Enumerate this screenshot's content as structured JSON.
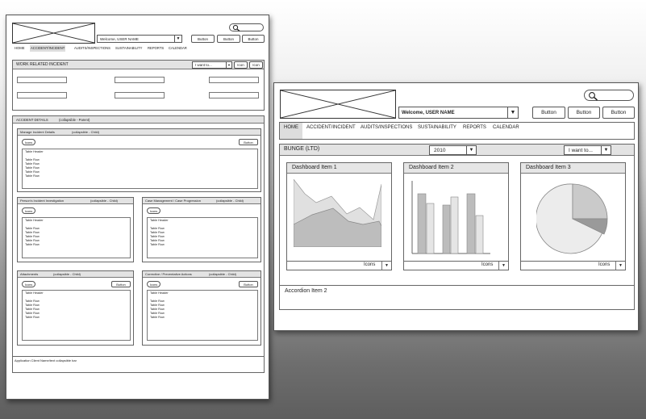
{
  "left": {
    "welcome": "Welcome, USER NAME",
    "buttons": [
      "Button",
      "Button",
      "Button"
    ],
    "nav": [
      "HOME",
      "ACCIDENT/INCIDENT",
      "AUDITS/INSPECTIONS",
      "SUSTAINABILITY",
      "REPORTS",
      "CALENDAR"
    ],
    "incident_title": "WORK RELATED INCIDENT",
    "i_want": "I want to...",
    "icon1": "Icon",
    "icon2": "Icon",
    "accident_details": "ACCIDENT DETAILS",
    "parent_note": "(collapsible - Parent)",
    "child_note": "(collapsible - Child)",
    "manage": "Manage Incident Details",
    "icons_pill": "Icons",
    "button": "Button",
    "table_header": "Table Header",
    "table_row": "Table Row",
    "persons": "Person's Incident Investigation",
    "case": "Case Management / Case Progression",
    "attachments": "Attachments",
    "corrective": "Corrective / Preventative Actions",
    "footer": "Application Client Name/text collapsible bar"
  },
  "right": {
    "welcome": "Welcome, USER NAME",
    "buttons": [
      "Button",
      "Button",
      "Button"
    ],
    "nav": [
      "HOME",
      "ACCIDENT/INCIDENT",
      "AUDITS/INSPECTIONS",
      "SUSTAINABILITY",
      "REPORTS",
      "CALENDAR"
    ],
    "company": "BUNGE (LTD)",
    "year": "2010",
    "i_want": "I want to...",
    "items": [
      "Dashboard Item 1",
      "Dashboard Item 2",
      "Dashboard Item 3"
    ],
    "icons_label": "Icons",
    "accordion": "Accordion Item 2"
  },
  "icons": {
    "search": "search-icon",
    "dropdown": "chevron-down-icon",
    "logo": "logo-placeholder"
  }
}
